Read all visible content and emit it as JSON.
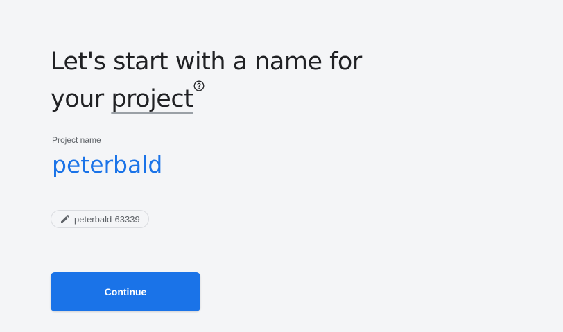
{
  "heading": {
    "line1": "Let's start with a name for",
    "line2_prefix": "your ",
    "line2_term": "project",
    "help_icon": "help-circle-icon"
  },
  "project_name_field": {
    "label": "Project name",
    "value": "peterbald"
  },
  "project_id_chip": {
    "icon": "pencil-icon",
    "text": "peterbald-63339"
  },
  "continue_button": {
    "label": "Continue"
  },
  "colors": {
    "accent": "#1a73e8",
    "background": "#f4f5f7",
    "text": "#202124",
    "muted": "#5f6368"
  }
}
